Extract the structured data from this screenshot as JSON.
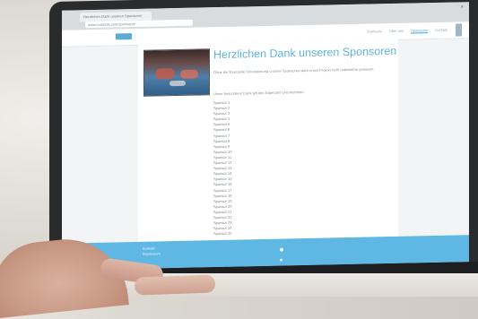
{
  "browser": {
    "tab_title": "Herzlichen Dank unseren Sponsoren",
    "url": "www.example.com/sponsoren"
  },
  "site": {
    "nav": [
      "Startseite",
      "Über uns",
      "Sponsoren",
      "Kontakt"
    ],
    "active_nav": "Sponsoren"
  },
  "page": {
    "headline": "Herzlichen Dank unseren Sponsoren",
    "intro": "Ohne die finanzielle Unterstützung unserer Sponsoren wäre unser Projekt nicht realisierbar gewesen.",
    "intro2": "Unser besonderer Dank gilt den folgenden Unternehmen:",
    "sponsors": [
      "Sponsor 1",
      "Sponsor 2",
      "Sponsor 3",
      "Sponsor 4",
      "Sponsor 5",
      "Sponsor 6",
      "Sponsor 7",
      "Sponsor 8",
      "Sponsor 9",
      "Sponsor 10",
      "Sponsor 11",
      "Sponsor 12",
      "Sponsor 13",
      "Sponsor 14",
      "Sponsor 15",
      "Sponsor 16",
      "Sponsor 17",
      "Sponsor 18",
      "Sponsor 19",
      "Sponsor 20",
      "Sponsor 21",
      "Sponsor 22",
      "Sponsor 23",
      "Sponsor 24",
      "Sponsor 25"
    ]
  },
  "footer": {
    "line1": "Kontakt",
    "line2": "Impressum"
  },
  "colors": {
    "accent": "#5fb3e0",
    "footer": "#5fb7e3"
  }
}
